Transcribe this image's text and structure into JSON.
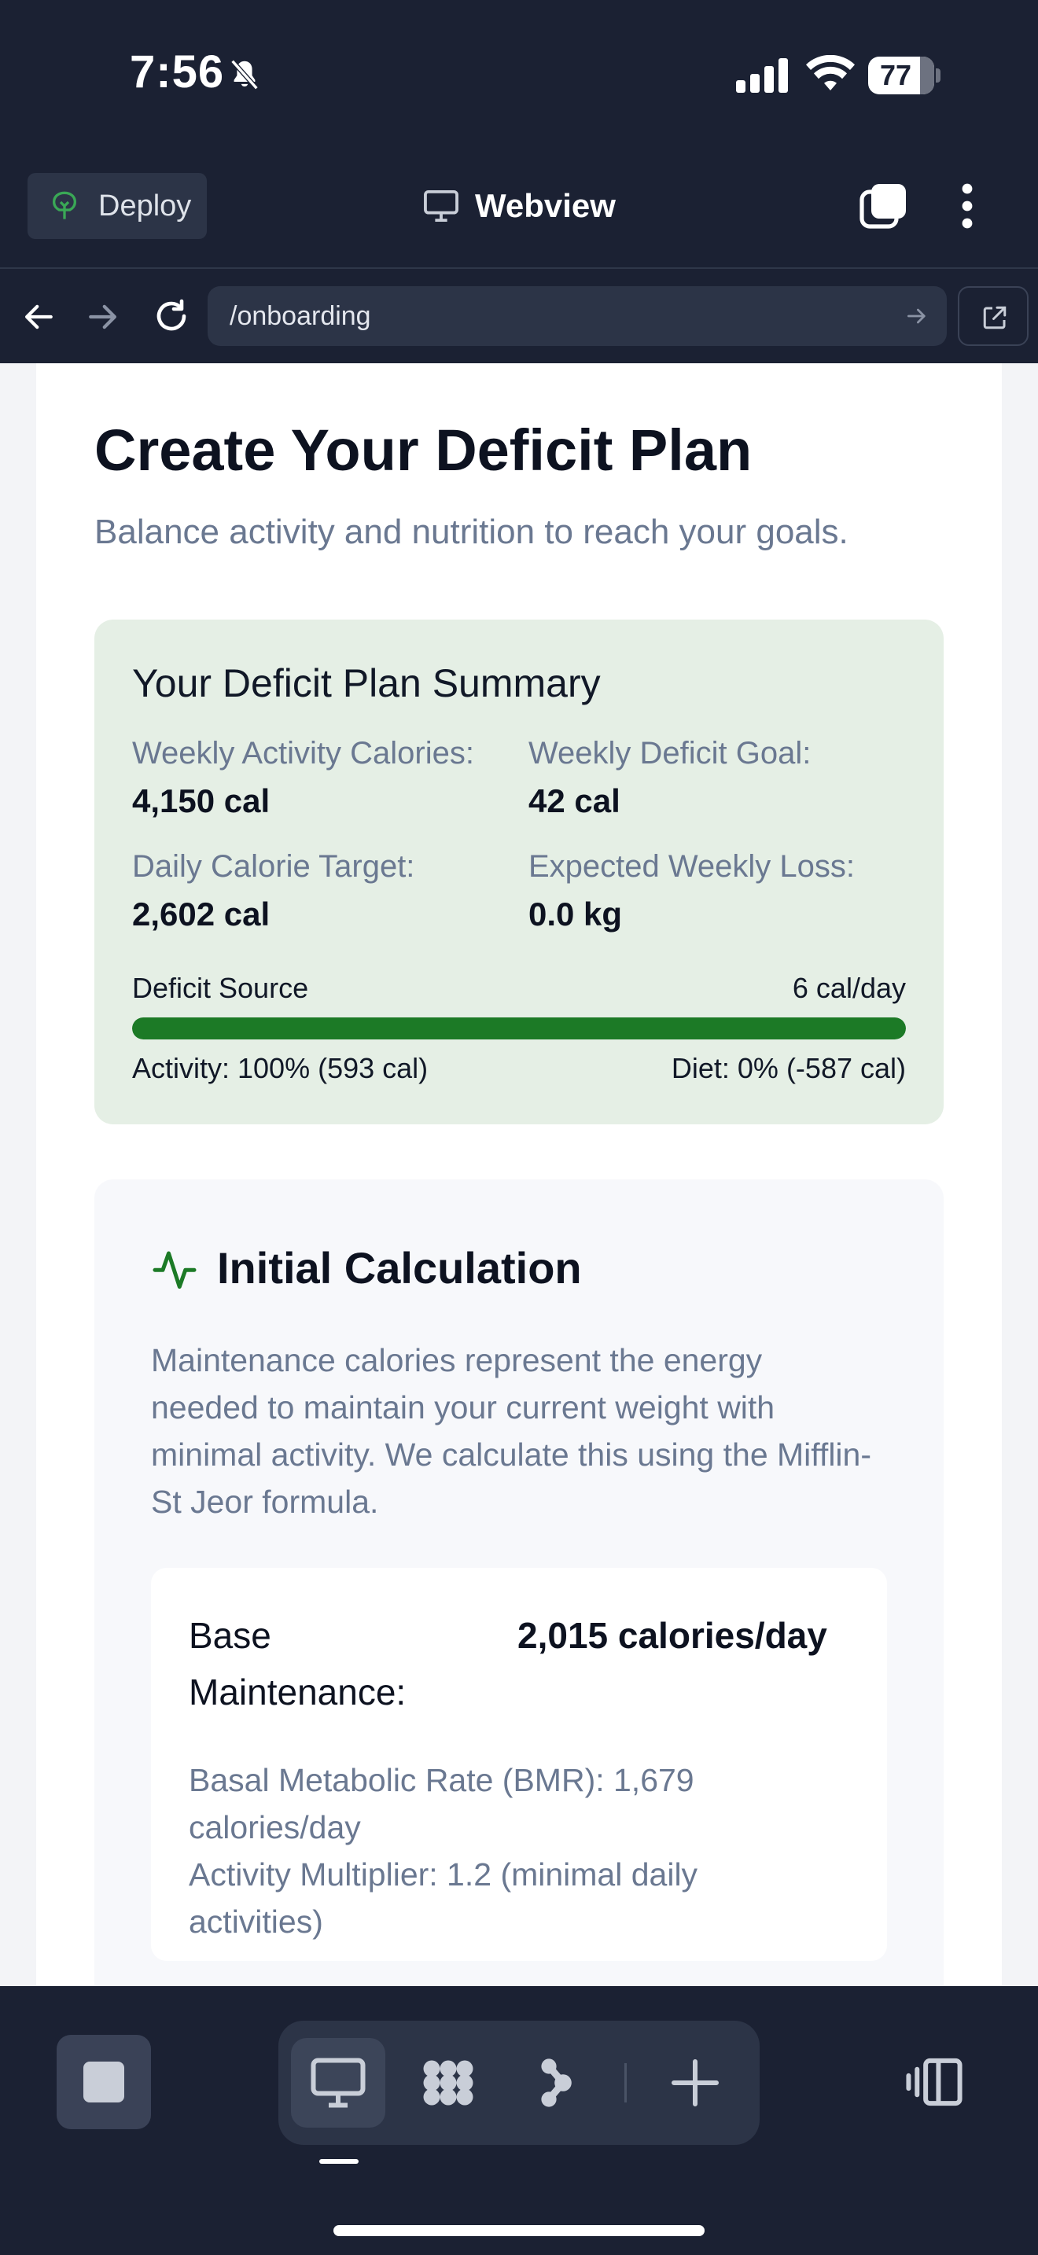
{
  "status_bar": {
    "time": "7:56",
    "battery": "77",
    "icons": [
      "bell-slash-icon",
      "cellular-signal-icon",
      "wifi-icon",
      "battery-icon"
    ]
  },
  "toolbar": {
    "deploy_label": "Deploy",
    "title": "Webview",
    "icons": [
      "deploy-icon",
      "monitor-icon",
      "tabs-icon",
      "more-vertical-icon"
    ]
  },
  "url_bar": {
    "url": "/onboarding",
    "icons": [
      "back-arrow-icon",
      "forward-arrow-icon",
      "reload-icon",
      "go-arrow-icon",
      "external-link-icon"
    ]
  },
  "page": {
    "title": "Create Your Deficit Plan",
    "subtitle": "Balance activity and nutrition to reach your goals."
  },
  "summary": {
    "title": "Your Deficit Plan Summary",
    "weekly_activity_label": "Weekly Activity Calories:",
    "weekly_activity_value": "4,150 cal",
    "weekly_deficit_label": "Weekly Deficit Goal:",
    "weekly_deficit_value": "42 cal",
    "daily_target_label": "Daily Calorie Target:",
    "daily_target_value": "2,602 cal",
    "weekly_loss_label": "Expected Weekly Loss:",
    "weekly_loss_value": "0.0 kg",
    "deficit_source_label": "Deficit Source",
    "deficit_source_value": "6 cal/day",
    "activity_split": "Activity: 100% (593 cal)",
    "diet_split": "Diet: 0% (-587 cal)",
    "activity_fraction": 1.0,
    "bar_color": "#1c7a26"
  },
  "calculation": {
    "icon": "activity-pulse-icon",
    "title": "Initial Calculation",
    "description": "Maintenance calories represent the energy needed to maintain your current weight with minimal activity. We calculate this using the Mifflin-St Jeor formula.",
    "base_label": "Base Maintenance:",
    "base_value": "2,015 calories/day",
    "bmr_line": "Basal Metabolic Rate (BMR): 1,679 calories/day",
    "multiplier_line": "Activity Multiplier: 1.2 (minimal daily activities)"
  },
  "dock": {
    "active_view": "desktop-view",
    "icons": [
      "stop-icon",
      "desktop-view-icon",
      "grid-apps-icon",
      "flow-icon",
      "add-icon",
      "side-panel-icon"
    ]
  },
  "colors": {
    "chrome_bg": "#1b2133",
    "accent_green": "#1c7a26",
    "summary_bg": "#e5efe5",
    "muted_text": "#6a7891"
  }
}
